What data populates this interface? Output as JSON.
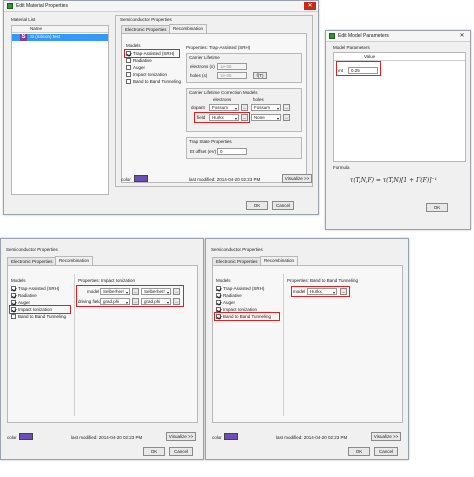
{
  "matwin": {
    "title": "Edit Material Properties",
    "material_list_label": "Material List",
    "tree_header": "Name",
    "tree_item": "Si (Silicon) test",
    "color_label": "color",
    "last_modified": "last modified: 2014-04-20 02:23 PM",
    "visualize_btn": "Visualize >>",
    "ok_btn": "OK",
    "cancel_btn": "Cancel",
    "semi": {
      "title": "Semiconductor Properties",
      "tabs": [
        "Electronic Properties",
        "Recombination"
      ],
      "models_label": "Models",
      "models": [
        {
          "label": "Trap-Assisted (SRH)",
          "checked": true
        },
        {
          "label": "Radiative",
          "checked": false
        },
        {
          "label": "Auger",
          "checked": false
        },
        {
          "label": "Impact Ionization",
          "checked": false
        },
        {
          "label": "Band to Band Tunneling",
          "checked": false
        }
      ],
      "props_title": "Properties: Trap-Assisted (SRH)",
      "carrier_lifetime": "Carrier Lifetime",
      "electrons_label": "electrons (s)",
      "electrons_value": "1e-06",
      "holes_label": "holes (s)",
      "holes_value": "1e-06",
      "fx_btn": "f(T)",
      "correction_title": "Carrier Lifetime Correction Models",
      "col_electrons": "electrons",
      "col_holes": "holes",
      "dopant_label": "dopant",
      "dopant_e": "Fossum",
      "dopant_h": "Fossum",
      "field_label": "field",
      "field_e": "Hurkx",
      "field_h": "None",
      "trap_title": "Trap State Properties",
      "offset_label": "Et offset (eV)",
      "offset_value": "0"
    }
  },
  "modelwin": {
    "title": "Edit Model Parameters",
    "params_label": "Model Parameters",
    "value_header": "Value",
    "row_name": "mt",
    "row_value": "0.25",
    "formula_label": "Formula",
    "formula": "τ(T,N,F) = τ(T,N)[1 + Γ(F)]⁻¹"
  },
  "win2": {
    "title": "Semiconductor Properties",
    "tabs": [
      "Electronic Properties",
      "Recombination"
    ],
    "models_label": "Models",
    "models": [
      {
        "label": "Trap-Assisted (SRH)",
        "checked": true
      },
      {
        "label": "Radiative",
        "checked": true
      },
      {
        "label": "Auger",
        "checked": true
      },
      {
        "label": "Impact Ionization",
        "checked": true
      },
      {
        "label": "Band to Band Tunneling",
        "checked": false
      }
    ],
    "props_title": "Properties: Impact Ionization",
    "model_label": "model",
    "model_e": "Selberherr",
    "model_h": "Selberherr",
    "driving_label": "driving field",
    "driving_e": "grad.phi",
    "driving_h": "grad.phi",
    "color_label": "color",
    "last_modified": "last modified: 2014-04-20 02:23 PM",
    "visualize_btn": "Visualize >>",
    "ok_btn": "OK",
    "cancel_btn": "Cancel"
  },
  "win3": {
    "title": "Semiconductor Properties",
    "tabs": [
      "Electronic Properties",
      "Recombination"
    ],
    "models_label": "Models",
    "models": [
      {
        "label": "Trap-Assisted (SRH)",
        "checked": true
      },
      {
        "label": "Radiative",
        "checked": true
      },
      {
        "label": "Auger",
        "checked": true
      },
      {
        "label": "Impact Ionization",
        "checked": true
      },
      {
        "label": "Band to Band Tunneling",
        "checked": true
      }
    ],
    "props_title": "Properties: Band to Band Tunneling",
    "model_label": "model",
    "model_value": "Hurkx",
    "color_label": "color",
    "last_modified": "last modified: 2014-04-20 02:23 PM",
    "visualize_btn": "Visualize >>",
    "ok_btn": "OK",
    "cancel_btn": "Cancel"
  },
  "colors": {
    "highlight": "#e02020",
    "swatch": "#6a4fb8",
    "selection": "#3399ff"
  }
}
